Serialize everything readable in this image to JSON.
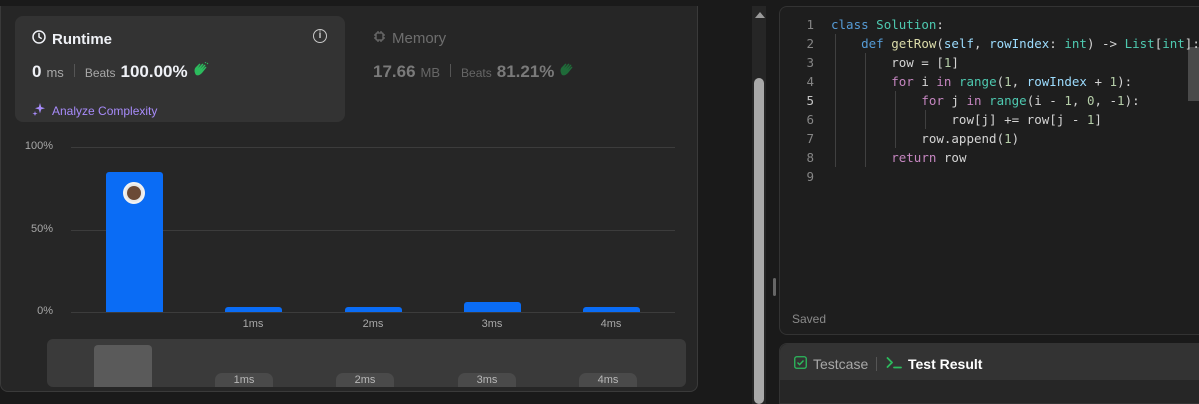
{
  "runtime": {
    "title": "Runtime",
    "value": "0",
    "unit": "ms",
    "beats_label": "Beats",
    "beats_value": "100.00%",
    "analyze_label": "Analyze Complexity"
  },
  "memory": {
    "title": "Memory",
    "value": "17.66",
    "unit": "MB",
    "beats_label": "Beats",
    "beats_value": "81.21%"
  },
  "chart_data": {
    "type": "bar",
    "categories": [
      "0ms",
      "1ms",
      "2ms",
      "3ms",
      "4ms"
    ],
    "x_tick_labels": [
      "",
      "1ms",
      "2ms",
      "3ms",
      "4ms"
    ],
    "values": [
      85,
      3,
      3,
      6,
      3
    ],
    "y_tick_labels": [
      "100%",
      "50%",
      "0%"
    ],
    "ylim": [
      0,
      100
    ],
    "highlight_index": 0,
    "bar_color": "#0a6cf5",
    "grid": true
  },
  "minimap": {
    "labels": [
      "1ms",
      "2ms",
      "3ms",
      "4ms"
    ]
  },
  "editor": {
    "status": "Saved",
    "line_numbers": [
      "1",
      "2",
      "3",
      "4",
      "5",
      "6",
      "7",
      "8",
      "9"
    ],
    "lines": [
      "class Solution:",
      "    def getRow(self, rowIndex: int) -> List[int]:",
      "        row = [1]",
      "        for i in range(1, rowIndex + 1):",
      "            for j in range(i - 1, 0, -1):",
      "                row[j] += row[j - 1]",
      "            row.append(1)",
      "        return row",
      ""
    ]
  },
  "tabs": {
    "testcase": "Testcase",
    "test_result": "Test Result"
  },
  "colors": {
    "accent": "#0a6cf5",
    "success": "#2cbb5d",
    "purple": "#a78bfa"
  }
}
